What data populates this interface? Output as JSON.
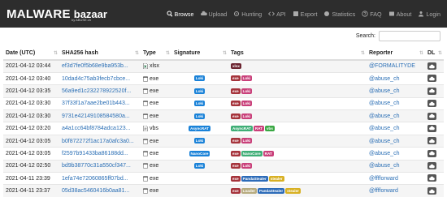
{
  "logo": {
    "main": "MALWARE",
    "sub": "bazaar",
    "by": "by ABUSE.ch"
  },
  "nav": [
    {
      "label": "Browse",
      "icon": "search-icon",
      "active": true
    },
    {
      "label": "Upload",
      "icon": "upload-icon",
      "active": false
    },
    {
      "label": "Hunting",
      "icon": "hunting-icon",
      "active": false
    },
    {
      "label": "API",
      "icon": "code-icon",
      "active": false
    },
    {
      "label": "Export",
      "icon": "export-icon",
      "active": false
    },
    {
      "label": "Statistics",
      "icon": "statistics-icon",
      "active": false
    },
    {
      "label": "FAQ",
      "icon": "question-icon",
      "active": false
    },
    {
      "label": "About",
      "icon": "about-icon",
      "active": false
    },
    {
      "label": "Login",
      "icon": "user-icon",
      "active": false
    }
  ],
  "search": {
    "label": "Search:",
    "value": ""
  },
  "columns": {
    "date": "Date (UTC)",
    "hash": "SHA256 hash",
    "type": "Type",
    "signature": "Signature",
    "tags": "Tags",
    "reporter": "Reporter",
    "dl": "DL"
  },
  "colors": {
    "exe": "#a5333b",
    "xlsx": "#6b2430",
    "loki": "#1a82d8",
    "asyncrat": "#1a82d8",
    "nanocore": "#1a82d8",
    "tag_asyncrat": "#3fae76",
    "tag_rat": "#c9407a",
    "tag_vbs": "#3aa844",
    "tag_nanocore": "#3fae76",
    "tag_loki": "#c9407a",
    "tag_pandastealer": "#2c6bb8",
    "tag_stealer": "#d8b023",
    "tag_loader": "#b7ab7f"
  },
  "rows": [
    {
      "date": "2021-04-12 03:44",
      "hash": "ef3d7fe0f5b68e9ba953b...",
      "type": "xlsx",
      "type_icon": "excel-file-icon",
      "signature": "",
      "tags": [
        {
          "text": "xlsx",
          "color": "#6b2430"
        }
      ],
      "reporter": "@FORMALITYDE"
    },
    {
      "date": "2021-04-12 03:40",
      "hash": "10dad4c75ab3fecb7cbce...",
      "type": "exe",
      "type_icon": "exe-file-icon",
      "signature": "Loki",
      "tags": [
        {
          "text": "exe",
          "color": "#a5333b"
        },
        {
          "text": "Loki",
          "color": "#c9407a"
        }
      ],
      "reporter": "@abuse_ch"
    },
    {
      "date": "2021-04-12 03:35",
      "hash": "56a9ed1c232278922520f...",
      "type": "exe",
      "type_icon": "exe-file-icon",
      "signature": "Loki",
      "tags": [
        {
          "text": "exe",
          "color": "#a5333b"
        },
        {
          "text": "Loki",
          "color": "#c9407a"
        }
      ],
      "reporter": "@abuse_ch"
    },
    {
      "date": "2021-04-12 03:30",
      "hash": "37f33f1a7aae2be01b443...",
      "type": "exe",
      "type_icon": "exe-file-icon",
      "signature": "Loki",
      "tags": [
        {
          "text": "exe",
          "color": "#a5333b"
        },
        {
          "text": "Loki",
          "color": "#c9407a"
        }
      ],
      "reporter": "@abuse_ch"
    },
    {
      "date": "2021-04-12 03:30",
      "hash": "9731e42149108584580a...",
      "type": "exe",
      "type_icon": "exe-file-icon",
      "signature": "Loki",
      "tags": [
        {
          "text": "exe",
          "color": "#a5333b"
        },
        {
          "text": "Loki",
          "color": "#c9407a"
        }
      ],
      "reporter": "@abuse_ch"
    },
    {
      "date": "2021-04-12 03:20",
      "hash": "a4a1cc64bf8784adca123...",
      "type": "vbs",
      "type_icon": "script-file-icon",
      "signature": "AsyncRAT",
      "tags": [
        {
          "text": "AsyncRAT",
          "color": "#3fae76"
        },
        {
          "text": "RAT",
          "color": "#c9407a"
        },
        {
          "text": "vbs",
          "color": "#3aa844"
        }
      ],
      "reporter": "@abuse_ch"
    },
    {
      "date": "2021-04-12 03:05",
      "hash": "b0f872272f1ac17a0afc3a0...",
      "type": "exe",
      "type_icon": "exe-file-icon",
      "signature": "Loki",
      "tags": [
        {
          "text": "exe",
          "color": "#a5333b"
        },
        {
          "text": "Loki",
          "color": "#c9407a"
        }
      ],
      "reporter": "@abuse_ch"
    },
    {
      "date": "2021-04-12 03:05",
      "hash": "f2597b91433ba86188dd...",
      "type": "exe",
      "type_icon": "exe-file-icon",
      "signature": "NanoCore",
      "tags": [
        {
          "text": "exe",
          "color": "#a5333b"
        },
        {
          "text": "NanoCore",
          "color": "#3fae76"
        },
        {
          "text": "RAT",
          "color": "#c9407a"
        }
      ],
      "reporter": "@abuse_ch"
    },
    {
      "date": "2021-04-12 02:50",
      "hash": "bd9b38770c31a550cf347...",
      "type": "exe",
      "type_icon": "exe-file-icon",
      "signature": "Loki",
      "tags": [
        {
          "text": "exe",
          "color": "#a5333b"
        },
        {
          "text": "Loki",
          "color": "#c9407a"
        }
      ],
      "reporter": "@abuse_ch"
    },
    {
      "date": "2021-04-11 23:39",
      "hash": "1efa74e72060865ff07bd...",
      "type": "exe",
      "type_icon": "exe-file-icon",
      "signature": "",
      "tags": [
        {
          "text": "exe",
          "color": "#a5333b"
        },
        {
          "text": "PandaStealer",
          "color": "#2c6bb8"
        },
        {
          "text": "stealer",
          "color": "#d8b023"
        }
      ],
      "reporter": "@fffforward"
    },
    {
      "date": "2021-04-11 23:37",
      "hash": "05d38ac5460416b0aa81...",
      "type": "exe",
      "type_icon": "exe-file-icon",
      "signature": "",
      "tags": [
        {
          "text": "exe",
          "color": "#a5333b"
        },
        {
          "text": "Loader",
          "color": "#b7ab7f"
        },
        {
          "text": "PandaStealer",
          "color": "#2c6bb8"
        },
        {
          "text": "stealer",
          "color": "#d8b023"
        }
      ],
      "reporter": "@fffforward"
    }
  ]
}
